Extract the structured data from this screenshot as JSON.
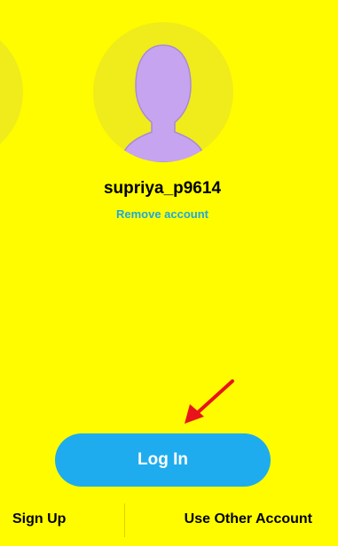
{
  "profile": {
    "username": "supriya_p9614",
    "remove_label": "Remove account",
    "avatar_icon": "default-bitmoji-silhouette-icon"
  },
  "actions": {
    "login_label": "Log In",
    "signup_label": "Sign Up",
    "other_account_label": "Use Other Account"
  },
  "annotation": {
    "arrow_icon": "red-pointer-arrow-icon",
    "arrow_color": "#E8141B"
  },
  "colors": {
    "background": "#FFFC00",
    "button": "#1EACEF",
    "link": "#1FA8DB",
    "avatar_fill": "#C6A4F0"
  }
}
